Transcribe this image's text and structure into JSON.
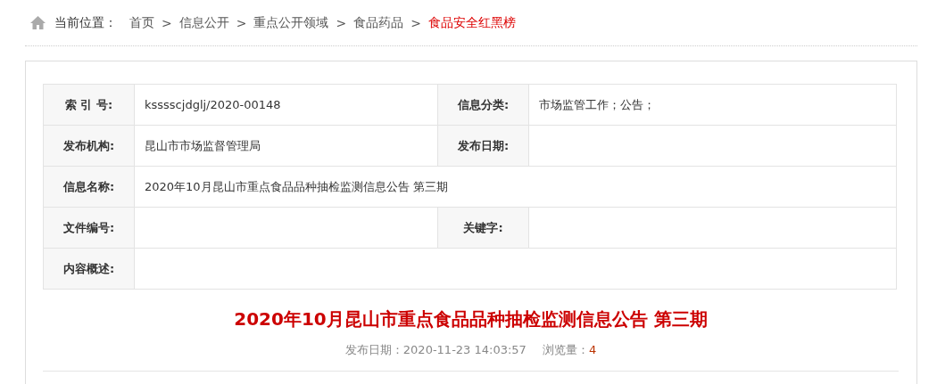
{
  "breadcrumb": {
    "label": "当前位置：",
    "items": [
      {
        "kind": "link",
        "text": "首页",
        "current": false
      },
      {
        "kind": "separator",
        "text": ">"
      },
      {
        "kind": "link",
        "text": "信息公开",
        "current": false
      },
      {
        "kind": "separator",
        "text": ">"
      },
      {
        "kind": "link",
        "text": "重点公开领域",
        "current": false
      },
      {
        "kind": "separator",
        "text": ">"
      },
      {
        "kind": "link",
        "text": "食品药品",
        "current": false
      },
      {
        "kind": "separator",
        "text": ">"
      },
      {
        "kind": "link",
        "text": "食品安全红黑榜",
        "current": true
      }
    ]
  },
  "info_table": {
    "rows": [
      {
        "kind": "pair",
        "cells": [
          {
            "label": "索 引 号:",
            "value": "ksssscjdglj/2020-00148"
          },
          {
            "label": "信息分类:",
            "value": "市场监管工作；公告；"
          }
        ]
      },
      {
        "kind": "pair",
        "cells": [
          {
            "label": "发布机构:",
            "value": "昆山市市场监督管理局"
          },
          {
            "label": "发布日期:"
          }
        ]
      },
      {
        "kind": "wide",
        "cells": [
          {
            "label": "信息名称:",
            "value": "2020年10月昆山市重点食品品种抽检监测信息公告 第三期"
          }
        ]
      },
      {
        "kind": "pair",
        "cells": [
          {
            "label": "文件编号:"
          },
          {
            "label": "关键字:"
          }
        ]
      },
      {
        "kind": "wide",
        "cells": [
          {
            "label": "内容概述:"
          }
        ]
      }
    ]
  },
  "article": {
    "title": "2020年10月昆山市重点食品品种抽检监测信息公告 第三期",
    "date_label": "发布日期：",
    "date": "2020-11-23 14:03:57",
    "views_label": "浏览量：",
    "views": "4"
  }
}
